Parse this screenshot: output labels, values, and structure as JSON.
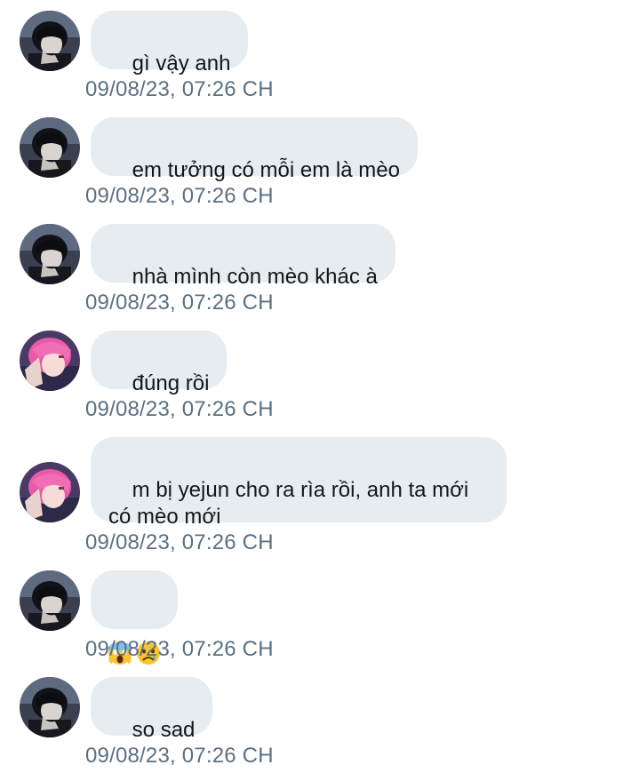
{
  "conversation": {
    "messages": [
      {
        "sender": "dark-hair-user",
        "text": "gì vậy anh",
        "time": "09/08/23, 07:26 CH"
      },
      {
        "sender": "dark-hair-user",
        "text": "em tưởng có mỗi em là mèo",
        "time": "09/08/23, 07:26 CH"
      },
      {
        "sender": "dark-hair-user",
        "text": "nhà mình còn mèo khác à",
        "time": "09/08/23, 07:26 CH"
      },
      {
        "sender": "pink-hair-user",
        "text": "đúng rồi",
        "time": "09/08/23, 07:26 CH"
      },
      {
        "sender": "pink-hair-user",
        "text": "m bị yejun cho ra rìa rồi, anh ta mới\ncó mèo mới",
        "time": "09/08/23, 07:26 CH"
      },
      {
        "sender": "dark-hair-user",
        "text": "😱😢",
        "time": "09/08/23, 07:26 CH"
      },
      {
        "sender": "dark-hair-user",
        "text": "so sad",
        "time": "09/08/23, 07:26 CH"
      }
    ]
  },
  "colors": {
    "bubble_bg": "#e6ecf0",
    "text": "#14171a",
    "timestamp": "#5b7083",
    "background": "#ffffff"
  },
  "icons": {
    "dark_avatar": "dark-hair-avatar-icon",
    "pink_avatar": "pink-hair-avatar-icon",
    "emoji_1": "face-screaming-in-fear",
    "emoji_2": "crying-face"
  }
}
